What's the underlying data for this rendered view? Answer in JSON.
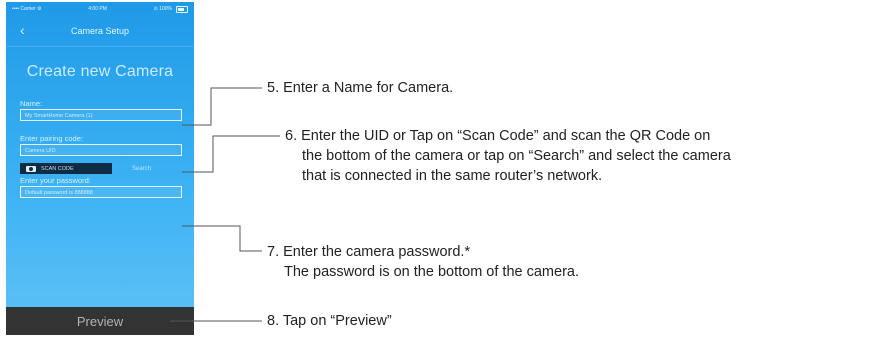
{
  "phone": {
    "status_left": "•••• Carrier ⚙",
    "status_time": "4:00 PM",
    "status_right": "⊙ 100%",
    "nav_back": "‹",
    "nav_title": "Camera Setup",
    "heading": "Create new Camera",
    "name_label": "Name:",
    "name_placeholder": "My SmartHome Camera (1)",
    "uid_label": "Enter pairing code:",
    "uid_placeholder": "Camera UID",
    "scan_label": "SCAN CODE",
    "search_label": "Search",
    "password_label": "Enter your password:",
    "password_placeholder": "Default password is 888888",
    "preview_label": "Preview"
  },
  "callouts": {
    "step5": "5. Enter a Name for Camera.",
    "step6_line1": "6. Enter the UID or Tap on “Scan Code” and scan the QR Code on",
    "step6_line2": "the bottom of the camera or tap on “Search” and select the camera",
    "step6_line3": "that is connected in the same router’s network.",
    "step7_line1": "7. Enter the camera password.*",
    "step7_line2": "The password is on the bottom of the camera.",
    "step8": "8. Tap on “Preview”"
  }
}
